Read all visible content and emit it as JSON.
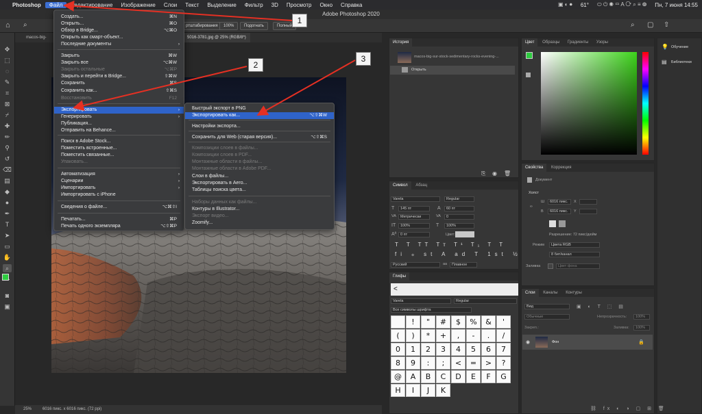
{
  "menubar": {
    "apple": "",
    "items": [
      "Photoshop",
      "Файл",
      "Редактирование",
      "Изображение",
      "Слои",
      "Текст",
      "Выделение",
      "Фильтр",
      "3D",
      "Просмотр",
      "Окно",
      "Справка"
    ],
    "battery": "61°",
    "datetime": "Пн, 7 июня  14:55"
  },
  "app_title": "Adobe Photoshop 2020",
  "options": {
    "zoom_pct": "100%",
    "fit": "Подогнать",
    "fill": "Полный",
    "scale": "ртштабирования"
  },
  "doc_tabs": {
    "first": "macos-big-",
    "second": "5016-3781.jpg @ 25% (RGB/8*)"
  },
  "status": {
    "zoom": "25%",
    "info": "6016 пикс. х 6016 пикс. (72 ppi)"
  },
  "file_menu": {
    "items": [
      {
        "label": "Создать...",
        "sc": "⌘N"
      },
      {
        "label": "Открыть...",
        "sc": "⌘O"
      },
      {
        "label": "Обзор в Bridge...",
        "sc": "⌥⌘O"
      },
      {
        "label": "Открыть как смарт-объект...",
        "sc": ""
      },
      {
        "label": "Последние документы",
        "sc": ""
      },
      {
        "label": "Закрыть",
        "sc": "⌘W"
      },
      {
        "label": "Закрыть все",
        "sc": "⌥⌘W"
      },
      {
        "label": "Закрыть остальные",
        "sc": "⌥⌘P"
      },
      {
        "label": "Закрыть и перейти в Bridge...",
        "sc": "⇧⌘W"
      },
      {
        "label": "Сохранить",
        "sc": "⌘S"
      },
      {
        "label": "Сохранить как...",
        "sc": "⇧⌘S"
      },
      {
        "label": "Восстановить",
        "sc": "F12"
      },
      {
        "label": "Экспортировать",
        "sc": ""
      },
      {
        "label": "Генерировать",
        "sc": ""
      },
      {
        "label": "Публикация...",
        "sc": ""
      },
      {
        "label": "Отправить на Behance...",
        "sc": ""
      },
      {
        "label": "Поиск в Adobe Stock...",
        "sc": ""
      },
      {
        "label": "Поместить встроенные...",
        "sc": ""
      },
      {
        "label": "Поместить связанные...",
        "sc": ""
      },
      {
        "label": "Упаковать...",
        "sc": ""
      },
      {
        "label": "Автоматизация",
        "sc": ""
      },
      {
        "label": "Сценарии",
        "sc": ""
      },
      {
        "label": "Импортировать",
        "sc": ""
      },
      {
        "label": "Импортировать с iPhone",
        "sc": ""
      },
      {
        "label": "Сведения о файле...",
        "sc": "⌥⌘⇧I"
      },
      {
        "label": "Печатать...",
        "sc": "⌘P"
      },
      {
        "label": "Печать одного экземпляра",
        "sc": "⌥⇧⌘P"
      }
    ]
  },
  "export_menu": {
    "items": [
      {
        "label": "Быстрый экспорт в PNG",
        "sc": ""
      },
      {
        "label": "Экспортировать как...",
        "sc": "⌥⇧⌘W"
      },
      {
        "label": "Настройки экспорта...",
        "sc": ""
      },
      {
        "label": "Сохранить для Web (старая версия)...",
        "sc": "⌥⇧⌘S"
      },
      {
        "label": "Композиции слоев в файлы...",
        "sc": ""
      },
      {
        "label": "Композиции слоев в PDF...",
        "sc": ""
      },
      {
        "label": "Монтажные области в файлы...",
        "sc": ""
      },
      {
        "label": "Монтажные области в Adobe PDF...",
        "sc": ""
      },
      {
        "label": "Слои в файлы...",
        "sc": ""
      },
      {
        "label": "Экспортировать в Aero...",
        "sc": ""
      },
      {
        "label": "Таблицы поиска цвета...",
        "sc": ""
      },
      {
        "label": "Наборы данных как файлы...",
        "sc": ""
      },
      {
        "label": "Контуры в Illustrator...",
        "sc": ""
      },
      {
        "label": "Экспорт видео...",
        "sc": ""
      },
      {
        "label": "Zoomify...",
        "sc": ""
      }
    ]
  },
  "callouts": [
    "1",
    "2",
    "3"
  ],
  "history": {
    "tab": "История",
    "snapshot": "macos-big-sur-stock-sedimentary-rocks-evening-...",
    "step": "Открыть"
  },
  "symbol": {
    "tabs": [
      "Символ",
      "Абзац"
    ],
    "font": "Varela",
    "style": "Regular",
    "size": "145 пт",
    "leading": "60 пт",
    "kerning": "Метрически",
    "tracking": "0",
    "vscale": "100%",
    "hscale": "100%",
    "baseline": "0 пт",
    "color_label": "Цвет:",
    "lang": "Русский",
    "aa": "Плавное"
  },
  "glyphs": {
    "tab": "Глифы",
    "recent": "<",
    "font": "Varela",
    "style": "Regular",
    "set": "Все символы шрифта",
    "chars": [
      "",
      "!",
      "\"",
      "#",
      "$",
      "%",
      "&",
      "'",
      "(",
      ")",
      "*",
      "+",
      ",",
      "-",
      ".",
      "/",
      "0",
      "1",
      "2",
      "3",
      "4",
      "5",
      "6",
      "7",
      "8",
      "9",
      ":",
      ";",
      "<",
      "=",
      ">",
      "?",
      "@",
      "A",
      "B",
      "C",
      "D",
      "E",
      "F",
      "G",
      "H",
      "I",
      "J",
      "K"
    ]
  },
  "color": {
    "tabs": [
      "Цвет",
      "Образцы",
      "Градиенты",
      "Узоры"
    ],
    "fg": "#2ecc40",
    "bg": "#ffffff"
  },
  "learn": {
    "learn": "Обучение",
    "libs": "Библиотеки"
  },
  "properties": {
    "tabs": [
      "Свойства",
      "Коррекция"
    ],
    "doc": "Документ",
    "canvas": "Холст",
    "w": "6016 пикс.",
    "h": "6016 пикс.",
    "x": "X",
    "y": "Y",
    "res": "Разрешение: 72 пикс/дюйм",
    "mode_label": "Режим",
    "mode": "Цвета RGB",
    "depth": "8 бит/канал",
    "fill_label": "Заливка",
    "fill": "Цвет фона"
  },
  "layers": {
    "tabs": [
      "Слои",
      "Каналы",
      "Контуры"
    ],
    "kind": "Вид",
    "blend": "Обычные",
    "opacity_label": "Непрозрачность:",
    "opacity": "100%",
    "lock": "Закреп.:",
    "fill_label": "Заливка:",
    "fill": "100%",
    "layer": "Фон"
  }
}
